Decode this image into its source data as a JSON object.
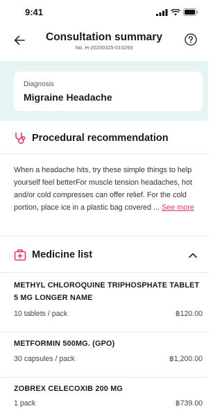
{
  "status": {
    "time": "9:41"
  },
  "header": {
    "title": "Consultation summary",
    "subtitle": "No. H-20200325-010293"
  },
  "diagnosis": {
    "label": "Diagnosis",
    "value": "Migraine Headache"
  },
  "procedural": {
    "title": "Procedural recommendation",
    "text": "When a headache hits, try these simple things to help yourself feel betterFor muscle tension headaches, hot and/or cold compresses can offer relief. For the cold portion, place ice in a plastic bag covered ... ",
    "see_more": "See more"
  },
  "medicine": {
    "title": "Medicine list",
    "items": [
      {
        "name": "METHYL CHLOROQUINE TRIPHOSPHATE TABLET 5 MG LONGER NAME",
        "qty": "10 tablets / pack",
        "price": "฿120.00"
      },
      {
        "name": "METFORMIN 500MG. (GPO)",
        "qty": "30 capsules / pack",
        "price": "฿1,200.00"
      },
      {
        "name": "ZOBREX CELECOXIB 200 MG",
        "qty": "1 pack",
        "price": "฿739.00"
      }
    ]
  },
  "colors": {
    "accent": "#e0336b",
    "diagnosis_bg": "#e6f4f4"
  },
  "icons": [
    "back-arrow-icon",
    "help-icon",
    "stethoscope-icon",
    "first-aid-kit-icon",
    "chevron-up-icon",
    "signal-icon",
    "wifi-icon",
    "battery-icon"
  ]
}
